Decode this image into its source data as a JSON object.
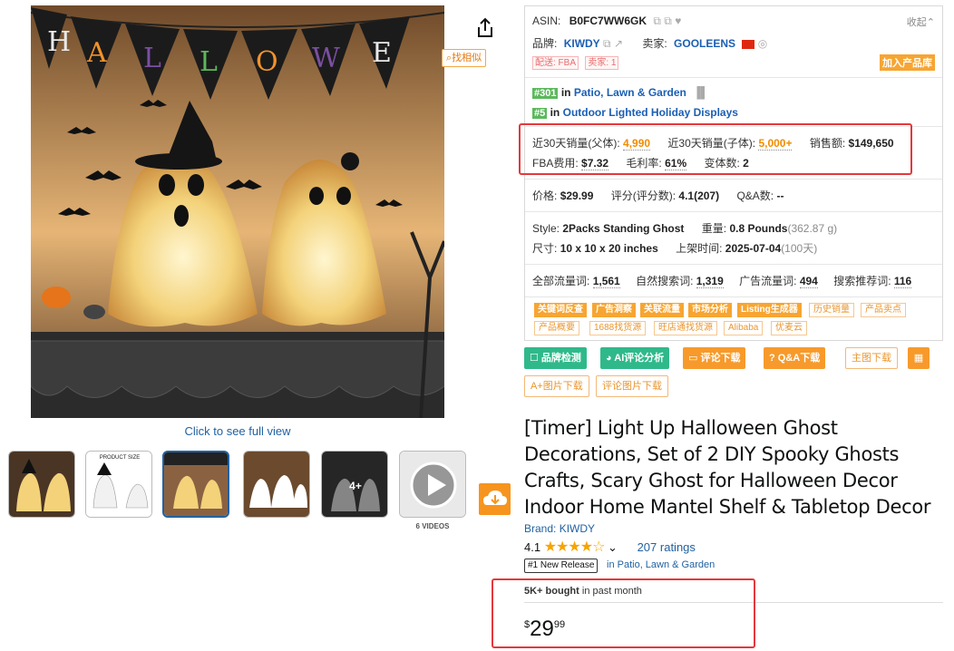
{
  "gallery": {
    "banner_letters": [
      "H",
      "A",
      "L",
      "L",
      "O",
      "W",
      "E"
    ],
    "find_similar": "找相似",
    "click_full_view": "Click to see full view",
    "thumb_size_label": "PRODUCT SIZE",
    "thumb_more": "4+",
    "videos_label": "6 VIDEOS"
  },
  "panel": {
    "asin_label": "ASIN:",
    "asin": "B0FC7WW6GK",
    "collapse": "收起",
    "brand_label": "品牌:",
    "brand": "KIWDY",
    "seller_label": "卖家:",
    "seller": "GOOLEENS",
    "tag_fba": "配送: FBA",
    "tag_sellers": "卖家: 1",
    "add_library": "加入产品库",
    "rank1_num": "#301",
    "rank1_in": "in",
    "rank1_cat": "Patio, Lawn & Garden",
    "rank2_num": "#5",
    "rank2_in": "in",
    "rank2_cat": "Outdoor Lighted Holiday Displays",
    "sales_parent_label": "近30天销量(父体):",
    "sales_parent": "4,990",
    "sales_child_label": "近30天销量(子体):",
    "sales_child": "5,000+",
    "revenue_label": "销售额:",
    "revenue": "$149,650",
    "fba_fee_label": "FBA费用:",
    "fba_fee": "$7.32",
    "margin_label": "毛利率:",
    "margin": "61%",
    "variants_label": "变体数:",
    "variants": "2",
    "price_label": "价格:",
    "price": "$29.99",
    "rating_label": "评分(评分数):",
    "rating": "4.1(207)",
    "qa_label": "Q&A数:",
    "qa": "--",
    "style_label": "Style:",
    "style": "2Packs Standing Ghost",
    "weight_label": "重量:",
    "weight": "0.8 Pounds",
    "weight_g": "(362.87 g)",
    "size_label": "尺寸:",
    "size": "10 x 10 x 20 inches",
    "listed_label": "上架时间:",
    "listed": "2025-07-04",
    "listed_days": "(100天)",
    "traffic_all_label": "全部流量词:",
    "traffic_all": "1,561",
    "traffic_organic_label": "自然搜索词:",
    "traffic_organic": "1,319",
    "traffic_ad_label": "广告流量词:",
    "traffic_ad": "494",
    "traffic_rec_label": "搜索推荐词:",
    "traffic_rec": "116",
    "tags_row1_solid": [
      "关键词反查",
      "广告洞察",
      "关联流量",
      "市场分析",
      "Listing生成器"
    ],
    "tags_row1_outline": [
      "历史销量",
      "产品卖点"
    ],
    "tags_row2_outline": [
      "产品概要",
      "1688找货源",
      "旺店通找货源",
      "Alibaba",
      "优麦云"
    ]
  },
  "actions": {
    "brand_check": "品牌检测",
    "ai_review": "AI评论分析",
    "review_download": "评论下载",
    "qa_download": "Q&A下载",
    "main_img_download": "主图下载",
    "aplus_download": "A+图片下载",
    "review_img_download": "评论图片下载"
  },
  "product": {
    "title": "[Timer] Light Up Halloween Ghost Decorations, Set of 2 DIY Spooky Ghosts Crafts, Scary Ghost for Halloween Decor Indoor Home Mantel Shelf & Tabletop Decor",
    "brand_link": "Brand: KIWDY",
    "rating_value": "4.1",
    "stars": "★★★★☆",
    "ratings_count": "207 ratings",
    "new_release": "#1 New Release",
    "new_release_cat": "in Patio, Lawn & Garden",
    "bought_bold": "5K+ bought",
    "bought_rest": " in past month",
    "price_symbol": "$",
    "price_whole": "29",
    "price_fraction": "99"
  },
  "colors": {
    "accent_orange": "#f7a532",
    "link_blue": "#1a5fb4",
    "highlight_red": "#e5383b",
    "green": "#2fb98a"
  }
}
